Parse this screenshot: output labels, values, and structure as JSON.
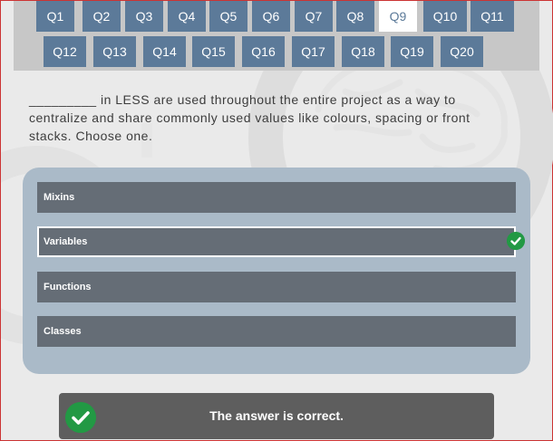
{
  "nav": {
    "row1": [
      "Q1",
      "Q2",
      "Q3",
      "Q4",
      "Q5",
      "Q6",
      "Q7",
      "Q8",
      "Q9",
      "Q10",
      "Q11"
    ],
    "row2": [
      "Q12",
      "Q13",
      "Q14",
      "Q15",
      "Q16",
      "Q17",
      "Q18",
      "Q19",
      "Q20"
    ],
    "active": "Q9"
  },
  "question": {
    "text": "_________ in LESS are used throughout the entire project as a way to centralize and share commonly used values like colours, spacing or front stacks. Choose one."
  },
  "options": [
    {
      "label": "Mixins",
      "selected": false
    },
    {
      "label": "Variables",
      "selected": true
    },
    {
      "label": "Functions",
      "selected": false
    },
    {
      "label": "Classes",
      "selected": false
    }
  ],
  "feedback": {
    "text": "The answer is correct.",
    "icon": "check-circle-icon"
  },
  "colors": {
    "nav_button": "#5c7a99",
    "correct": "#229944",
    "option_bg": "#656d76",
    "panel_bg": "#aabac8"
  }
}
